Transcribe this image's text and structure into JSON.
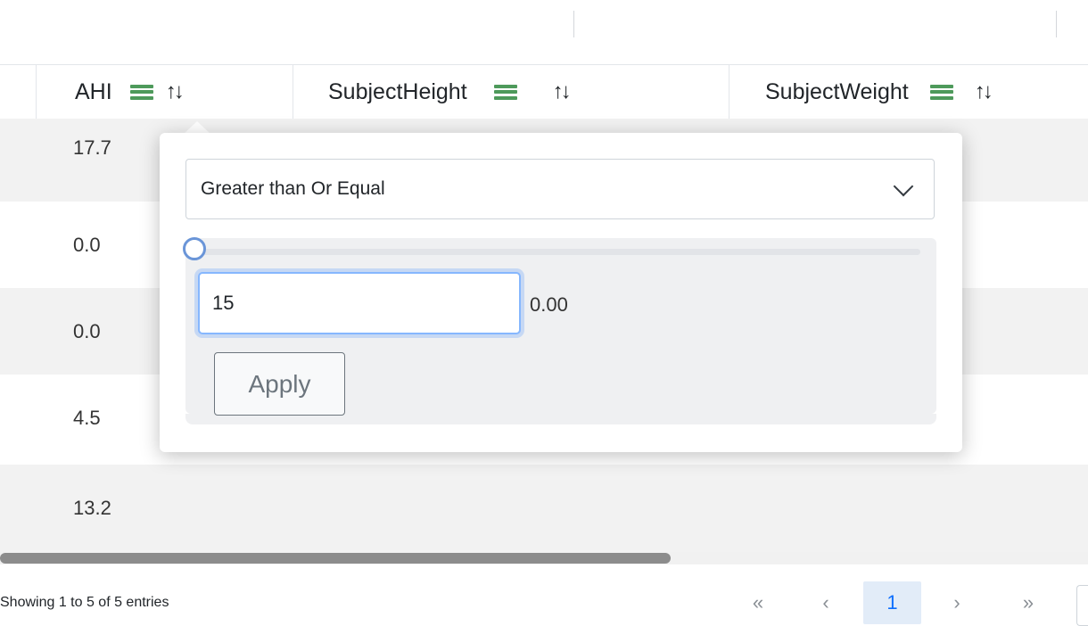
{
  "table": {
    "columns": [
      {
        "label": "AHI"
      },
      {
        "label": "SubjectHeight"
      },
      {
        "label": "SubjectWeight"
      }
    ],
    "rows": [
      {
        "ahi": "17.7"
      },
      {
        "ahi": "0.0"
      },
      {
        "ahi": "0.0"
      },
      {
        "ahi": "4.5"
      },
      {
        "ahi": "13.2"
      }
    ]
  },
  "filter_popover": {
    "operator_selected": "Greater than Or Equal",
    "input_value": "15",
    "range_value": "0.00",
    "apply_label": "Apply"
  },
  "pagination": {
    "info": "Showing 1 to 5 of 5 entries",
    "first": "«",
    "prev": "‹",
    "current_page": "1",
    "next": "›",
    "last": "»"
  },
  "colors": {
    "menu_icon": "#4e9a5b",
    "focus_border": "#86b7fe",
    "active_page_bg": "#e2ecf8"
  },
  "icons": [
    "menu-icon",
    "sort-icon",
    "chevron-down-icon",
    "first-page-icon",
    "prev-page-icon",
    "next-page-icon",
    "last-page-icon"
  ]
}
